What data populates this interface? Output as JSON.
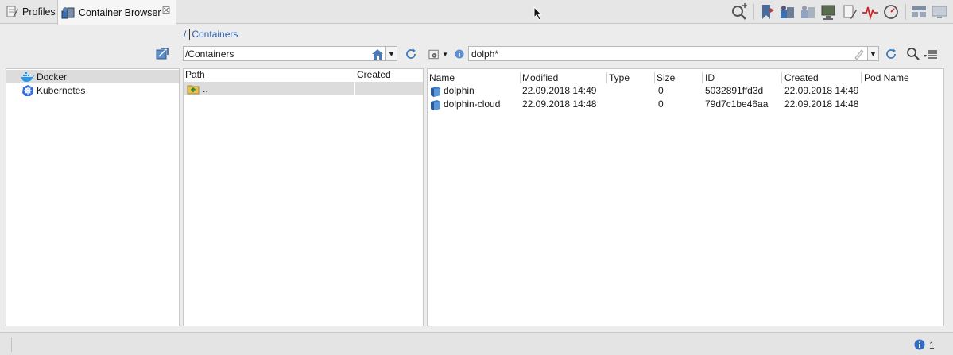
{
  "tabs": {
    "profiles": {
      "label": "Profiles",
      "icon": "profiles-icon"
    },
    "container_browser": {
      "label": "Container Browser",
      "icon": "container-browser-icon",
      "close": "☒"
    }
  },
  "breadcrumb": {
    "root": "/",
    "item": "Containers"
  },
  "left_tree": [
    {
      "label": "Docker",
      "icon": "docker-icon",
      "selected": true
    },
    {
      "label": "Kubernetes",
      "icon": "kubernetes-icon",
      "selected": false
    }
  ],
  "path": {
    "value": "/Containers"
  },
  "mid_table": {
    "columns": [
      "Path",
      "Created"
    ],
    "rows": [
      {
        "path": "..",
        "created": ""
      }
    ]
  },
  "filter": {
    "value": "dolph*"
  },
  "right_table": {
    "columns": [
      "Name",
      "Modified",
      "Type",
      "Size",
      "ID",
      "Created",
      "Pod Name"
    ],
    "rows": [
      {
        "name": "dolphin",
        "modified": "22.09.2018 14:49",
        "type": "",
        "size": "0",
        "id": "5032891ffd3d",
        "created": "22.09.2018 14:49",
        "pod": ""
      },
      {
        "name": "dolphin-cloud",
        "modified": "22.09.2018 14:48",
        "type": "",
        "size": "0",
        "id": "79d7c1be46aa",
        "created": "22.09.2018 14:48",
        "pod": ""
      }
    ]
  },
  "status": {
    "count": "1"
  },
  "colors": {
    "accent": "#2a5fb0",
    "selection": "#dcdcdc",
    "background": "#ececec"
  }
}
